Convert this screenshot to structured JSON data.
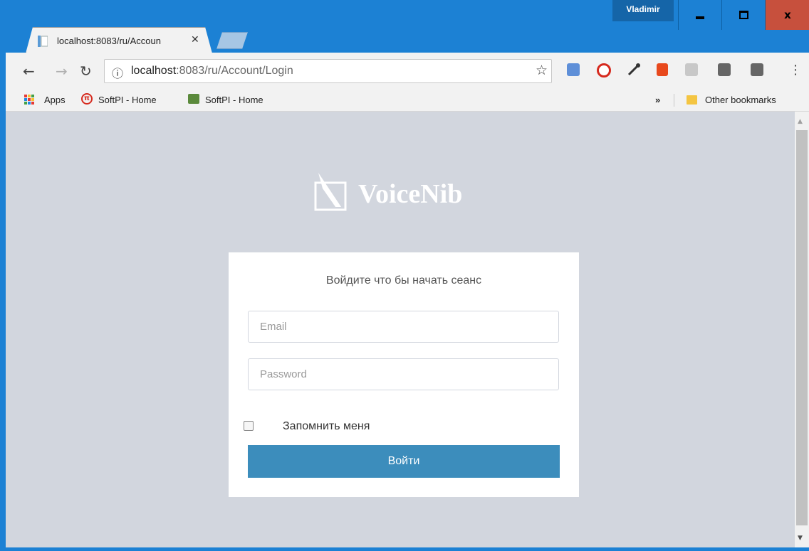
{
  "window": {
    "user": "Vladimir"
  },
  "tab": {
    "title": "localhost:8083/ru/Accoun"
  },
  "omnibox": {
    "url_host": "localhost",
    "url_rest": ":8083/ru/Account/Login"
  },
  "bookmarks": {
    "apps": "Apps",
    "items": [
      {
        "label": "SoftPI - Home"
      },
      {
        "label": "SoftPI - Home"
      }
    ],
    "overflow": "»",
    "other": "Other bookmarks"
  },
  "page": {
    "brand": "VoiceNib",
    "login_message": "Войдите что бы начать сеанс",
    "email_placeholder": "Email",
    "password_placeholder": "Password",
    "remember_label": "Запомнить меня",
    "remember_checked": false,
    "submit_label": "Войти"
  },
  "colors": {
    "window_frame": "#1c81d4",
    "page_background": "#d2d6de",
    "primary_button": "#3c8dbc",
    "close_button": "#c7503d"
  }
}
